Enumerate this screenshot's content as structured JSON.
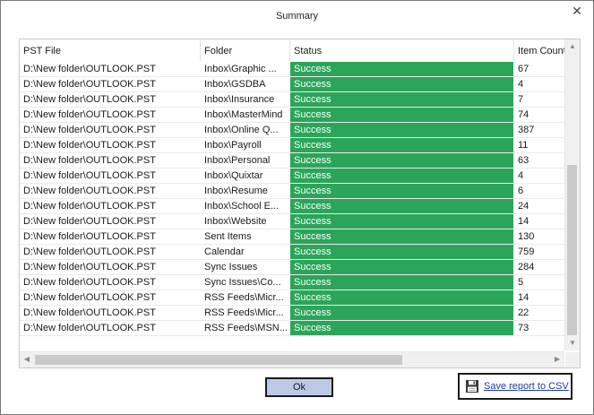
{
  "window": {
    "title": "Summary",
    "close_icon": "close-icon"
  },
  "grid": {
    "columns": [
      "PST File",
      "Folder",
      "Status",
      "Item Count"
    ],
    "rows": [
      {
        "pst": "D:\\New folder\\OUTLOOK.PST",
        "folder": "Inbox\\Graphic ...",
        "status": "Success",
        "count": "67"
      },
      {
        "pst": "D:\\New folder\\OUTLOOK.PST",
        "folder": "Inbox\\GSDBA",
        "status": "Success",
        "count": "4"
      },
      {
        "pst": "D:\\New folder\\OUTLOOK.PST",
        "folder": "Inbox\\Insurance",
        "status": "Success",
        "count": "7"
      },
      {
        "pst": "D:\\New folder\\OUTLOOK.PST",
        "folder": "Inbox\\MasterMind",
        "status": "Success",
        "count": "74"
      },
      {
        "pst": "D:\\New folder\\OUTLOOK.PST",
        "folder": "Inbox\\Online Q...",
        "status": "Success",
        "count": "387"
      },
      {
        "pst": "D:\\New folder\\OUTLOOK.PST",
        "folder": "Inbox\\Payroll",
        "status": "Success",
        "count": "11"
      },
      {
        "pst": "D:\\New folder\\OUTLOOK.PST",
        "folder": "Inbox\\Personal",
        "status": "Success",
        "count": "63"
      },
      {
        "pst": "D:\\New folder\\OUTLOOK.PST",
        "folder": "Inbox\\Quixtar",
        "status": "Success",
        "count": "4"
      },
      {
        "pst": "D:\\New folder\\OUTLOOK.PST",
        "folder": "Inbox\\Resume",
        "status": "Success",
        "count": "6"
      },
      {
        "pst": "D:\\New folder\\OUTLOOK.PST",
        "folder": "Inbox\\School E...",
        "status": "Success",
        "count": "24"
      },
      {
        "pst": "D:\\New folder\\OUTLOOK.PST",
        "folder": "Inbox\\Website",
        "status": "Success",
        "count": "14"
      },
      {
        "pst": "D:\\New folder\\OUTLOOK.PST",
        "folder": "Sent Items",
        "status": "Success",
        "count": "130"
      },
      {
        "pst": "D:\\New folder\\OUTLOOK.PST",
        "folder": "Calendar",
        "status": "Success",
        "count": "759"
      },
      {
        "pst": "D:\\New folder\\OUTLOOK.PST",
        "folder": "Sync Issues",
        "status": "Success",
        "count": "284"
      },
      {
        "pst": "D:\\New folder\\OUTLOOK.PST",
        "folder": "Sync Issues\\Co...",
        "status": "Success",
        "count": "5"
      },
      {
        "pst": "D:\\New folder\\OUTLOOK.PST",
        "folder": "RSS Feeds\\Micr...",
        "status": "Success",
        "count": "14"
      },
      {
        "pst": "D:\\New folder\\OUTLOOK.PST",
        "folder": "RSS Feeds\\Micr...",
        "status": "Success",
        "count": "22"
      },
      {
        "pst": "D:\\New folder\\OUTLOOK.PST",
        "folder": "RSS Feeds\\MSN...",
        "status": "Success",
        "count": "73"
      }
    ],
    "status_color": "#2ba559"
  },
  "footer": {
    "ok_label": "Ok",
    "save_label": "Save report to CSV",
    "save_icon": "floppy-disk-icon"
  }
}
